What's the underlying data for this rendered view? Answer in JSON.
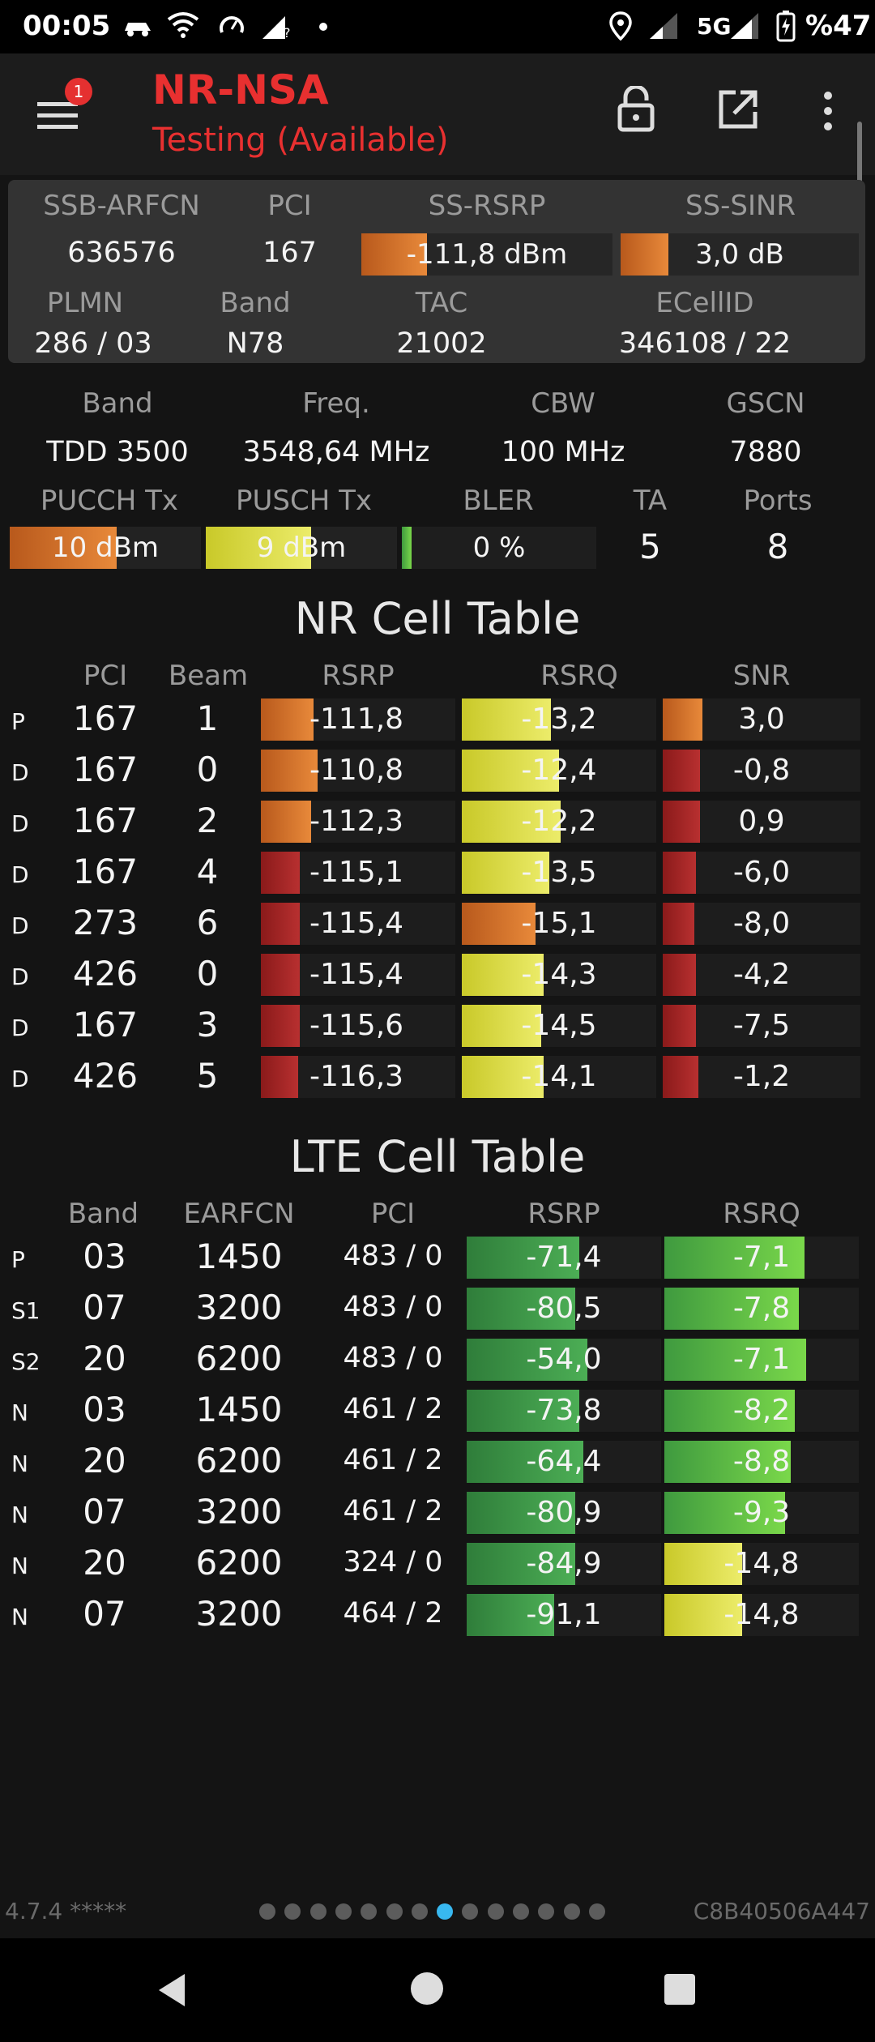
{
  "status": {
    "time": "00:05",
    "network": "5G",
    "battery": "%47"
  },
  "app": {
    "badge": "1",
    "title": "NR-NSA",
    "subtitle": "Testing (Available)"
  },
  "summary": {
    "h": {
      "arfcn": "SSB-ARFCN",
      "pci": "PCI",
      "rsrp": "SS-RSRP",
      "sinr": "SS-SINR",
      "plmn": "PLMN",
      "band": "Band",
      "tac": "TAC",
      "ecell": "ECellID"
    },
    "v": {
      "arfcn": "636576",
      "pci": "167",
      "rsrp": "-111,8 dBm",
      "sinr": "3,0 dB",
      "plmn": "286 / 03",
      "band": "N78",
      "tac": "21002",
      "ecell": "346108 / 22"
    },
    "rsrp_fill_pct": 26,
    "sinr_fill_pct": 20
  },
  "info": {
    "h": {
      "band": "Band",
      "freq": "Freq.",
      "cbw": "CBW",
      "gscn": "GSCN",
      "pucch": "PUCCH Tx",
      "pusch": "PUSCH Tx",
      "bler": "BLER",
      "ta": "TA",
      "ports": "Ports"
    },
    "v": {
      "band": "TDD 3500",
      "freq": "3548,64 MHz",
      "cbw": "100 MHz",
      "gscn": "7880",
      "pucch": "10 dBm",
      "pusch": "9 dBm",
      "bler": "0 %",
      "ta": "5",
      "ports": "8"
    },
    "pucch_fill_pct": 56,
    "pusch_fill_pct": 55,
    "bler_fill_pct": 5
  },
  "nr_table": {
    "title": "NR Cell Table",
    "headers": {
      "pci": "PCI",
      "beam": "Beam",
      "rsrp": "RSRP",
      "rsrq": "RSRQ",
      "snr": "SNR"
    },
    "rows": [
      {
        "tag": "P",
        "pci": "167",
        "beam": "1",
        "rsrp": "-111,8",
        "rsrq": "-13,2",
        "snr": "3,0",
        "rsrp_pct": 27,
        "rsrp_col": "orange",
        "rsrq_pct": 46,
        "rsrq_col": "yellow",
        "snr_pct": 20,
        "snr_col": "orange"
      },
      {
        "tag": "D",
        "pci": "167",
        "beam": "0",
        "rsrp": "-110,8",
        "rsrq": "-12,4",
        "snr": "-0,8",
        "rsrp_pct": 29,
        "rsrp_col": "orange",
        "rsrq_pct": 50,
        "rsrq_col": "yellow",
        "snr_pct": 19,
        "snr_col": "red"
      },
      {
        "tag": "D",
        "pci": "167",
        "beam": "2",
        "rsrp": "-112,3",
        "rsrq": "-12,2",
        "snr": "0,9",
        "rsrp_pct": 26,
        "rsrp_col": "orange",
        "rsrq_pct": 51,
        "rsrq_col": "yellow",
        "snr_pct": 19,
        "snr_col": "red"
      },
      {
        "tag": "D",
        "pci": "167",
        "beam": "4",
        "rsrp": "-115,1",
        "rsrq": "-13,5",
        "snr": "-6,0",
        "rsrp_pct": 20,
        "rsrp_col": "red",
        "rsrq_pct": 45,
        "rsrq_col": "yellow",
        "snr_pct": 17,
        "snr_col": "red"
      },
      {
        "tag": "D",
        "pci": "273",
        "beam": "6",
        "rsrp": "-115,4",
        "rsrq": "-15,1",
        "snr": "-8,0",
        "rsrp_pct": 20,
        "rsrp_col": "red",
        "rsrq_pct": 38,
        "rsrq_col": "orange",
        "snr_pct": 16,
        "snr_col": "red"
      },
      {
        "tag": "D",
        "pci": "426",
        "beam": "0",
        "rsrp": "-115,4",
        "rsrq": "-14,3",
        "snr": "-4,2",
        "rsrp_pct": 20,
        "rsrp_col": "red",
        "rsrq_pct": 42,
        "rsrq_col": "yellow",
        "snr_pct": 17,
        "snr_col": "red"
      },
      {
        "tag": "D",
        "pci": "167",
        "beam": "3",
        "rsrp": "-115,6",
        "rsrq": "-14,5",
        "snr": "-7,5",
        "rsrp_pct": 20,
        "rsrp_col": "red",
        "rsrq_pct": 41,
        "rsrq_col": "yellow",
        "snr_pct": 17,
        "snr_col": "red"
      },
      {
        "tag": "D",
        "pci": "426",
        "beam": "5",
        "rsrp": "-116,3",
        "rsrq": "-14,1",
        "snr": "-1,2",
        "rsrp_pct": 19,
        "rsrp_col": "red",
        "rsrq_pct": 42,
        "rsrq_col": "yellow",
        "snr_pct": 18,
        "snr_col": "red"
      }
    ]
  },
  "lte_table": {
    "title": "LTE Cell Table",
    "headers": {
      "band": "Band",
      "earfcn": "EARFCN",
      "pci": "PCI",
      "rsrp": "RSRP",
      "rsrq": "RSRQ"
    },
    "rows": [
      {
        "tag": "P",
        "band": "03",
        "earfcn": "1450",
        "pci": "483 / 0",
        "rsrp": "-71,4",
        "rsrq": "-7,1",
        "rsrp_pct": 58,
        "rsrq_pct": 72,
        "rsrq_col": "green"
      },
      {
        "tag": "S1",
        "band": "07",
        "earfcn": "3200",
        "pci": "483 / 0",
        "rsrp": "-80,5",
        "rsrq": "-7,8",
        "rsrp_pct": 56,
        "rsrq_pct": 69,
        "rsrq_col": "green"
      },
      {
        "tag": "S2",
        "band": "20",
        "earfcn": "6200",
        "pci": "483 / 0",
        "rsrp": "-54,0",
        "rsrq": "-7,1",
        "rsrp_pct": 62,
        "rsrq_pct": 73,
        "rsrq_col": "green"
      },
      {
        "tag": "N",
        "band": "03",
        "earfcn": "1450",
        "pci": "461 / 2",
        "rsrp": "-73,8",
        "rsrq": "-8,2",
        "rsrp_pct": 58,
        "rsrq_pct": 67,
        "rsrq_col": "green"
      },
      {
        "tag": "N",
        "band": "20",
        "earfcn": "6200",
        "pci": "461 / 2",
        "rsrp": "-64,4",
        "rsrq": "-8,8",
        "rsrp_pct": 60,
        "rsrq_pct": 65,
        "rsrq_col": "green"
      },
      {
        "tag": "N",
        "band": "07",
        "earfcn": "3200",
        "pci": "461 / 2",
        "rsrp": "-80,9",
        "rsrq": "-9,3",
        "rsrp_pct": 56,
        "rsrq_pct": 62,
        "rsrq_col": "green"
      },
      {
        "tag": "N",
        "band": "20",
        "earfcn": "6200",
        "pci": "324 / 0",
        "rsrp": "-84,9",
        "rsrq": "-14,8",
        "rsrp_pct": 56,
        "rsrq_pct": 40,
        "rsrq_col": "yellow"
      },
      {
        "tag": "N",
        "band": "07",
        "earfcn": "3200",
        "pci": "464 / 2",
        "rsrp": "-91,1",
        "rsrq": "-14,8",
        "rsrp_pct": 45,
        "rsrq_pct": 40,
        "rsrq_col": "yellow"
      }
    ]
  },
  "footer": {
    "version": "4.7.4 *****",
    "device_id": "C8B40506A447",
    "page_count": 14,
    "active_page": 7
  },
  "colors": {
    "orange": "linear-gradient(90deg,#b8591c,#e8893a)",
    "red": "linear-gradient(90deg,#8a1a1a,#b83030)",
    "yellow": "linear-gradient(90deg,#c9c929,#ecec6a)",
    "green": "linear-gradient(90deg,#3f9a3f,#7ad84a)",
    "green_rsrp": "linear-gradient(90deg,#2f7d3a,#4cae55)",
    "title_red": "#e83030"
  }
}
